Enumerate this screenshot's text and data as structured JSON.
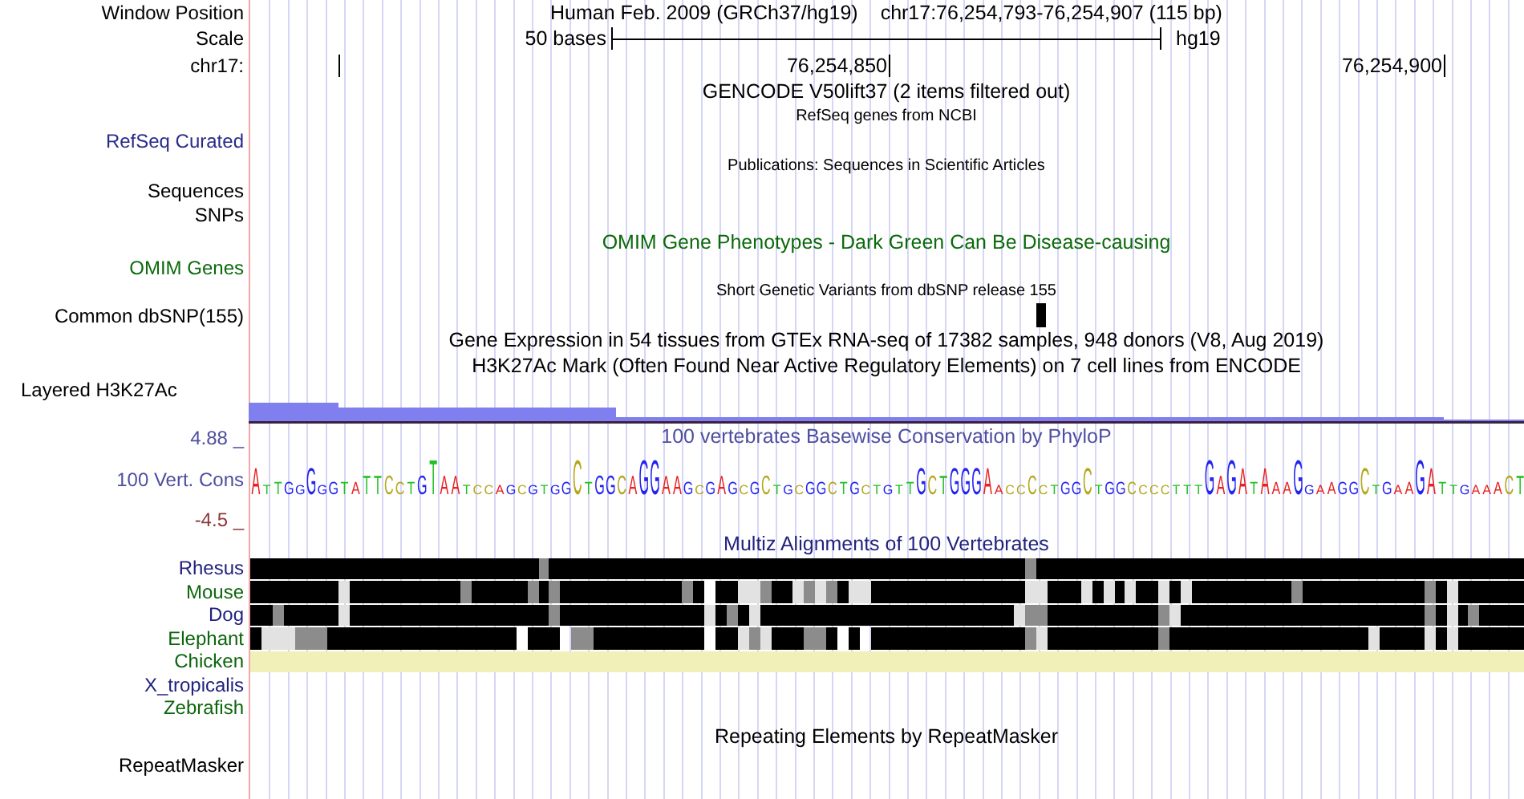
{
  "header": {
    "position_label": "Window Position",
    "assembly": "Human Feb. 2009 (GRCh37/hg19)",
    "position": "chr17:76,254,793-76,254,907 (115 bp)",
    "scale_label": "Scale",
    "scale": "50 bases",
    "scale_assembly": "hg19",
    "chrom_label": "chr17:",
    "tick_labels": [
      "76,254,850",
      "76,254,900"
    ]
  },
  "tracks": [
    {
      "kind": "gencode",
      "title": "GENCODE V50lift37 (2 items filtered out)"
    },
    {
      "kind": "refseq",
      "label": "RefSeq Curated",
      "title": "RefSeq genes from NCBI",
      "color": "#2a2a8c"
    },
    {
      "kind": "publications",
      "title": "Publications: Sequences in Scientific Articles"
    },
    {
      "kind": "sequences",
      "label": "Sequences",
      "color": "#000000"
    },
    {
      "kind": "snps",
      "label": "SNPs",
      "color": "#000000"
    },
    {
      "kind": "omim",
      "label": "OMIM Genes",
      "title": "OMIM Gene Phenotypes - Dark Green Can Be Disease-causing",
      "color": "#0b6a0b"
    },
    {
      "kind": "dbsnp",
      "label": "Common dbSNP(155)",
      "title": "Short Genetic Variants from dbSNP release 155",
      "color": "#000000"
    },
    {
      "kind": "gtex",
      "title": "Gene Expression in 54 tissues from GTEx RNA-seq of 17382 samples, 948 donors (V8, Aug 2019)"
    },
    {
      "kind": "h3k27ac",
      "label": "Layered H3K27Ac",
      "title": "H3K27Ac Mark (Often Found Near Active Regulatory Elements) on 7 cell lines from ENCODE",
      "color": "#000000"
    },
    {
      "kind": "phylop",
      "label": "100 Vert. Cons",
      "title": "100 vertebrates Basewise Conservation by PhyloP",
      "max": "4.88 _",
      "min": "-4.5 _",
      "color": "#4e4ea0",
      "bases": [
        {
          "base": "A",
          "kind": "high"
        },
        {
          "base": "T",
          "kind": "tiny"
        },
        {
          "base": "T",
          "kind": "low"
        },
        {
          "base": "G",
          "kind": "low"
        },
        {
          "base": "G",
          "kind": "tiny"
        },
        {
          "base": "G",
          "kind": "high"
        },
        {
          "base": "G",
          "kind": "tiny"
        },
        {
          "base": "G",
          "kind": "low"
        },
        {
          "base": "T",
          "kind": "low"
        },
        {
          "base": "A",
          "kind": "low"
        },
        {
          "base": "T",
          "kind": "mid"
        },
        {
          "base": "T",
          "kind": "mid"
        },
        {
          "base": "C",
          "kind": "mid"
        },
        {
          "base": "C",
          "kind": "low"
        },
        {
          "base": "T",
          "kind": "low"
        },
        {
          "base": "G",
          "kind": "mid"
        },
        {
          "base": "T",
          "kind": "tall"
        },
        {
          "base": "A",
          "kind": "mid"
        },
        {
          "base": "A",
          "kind": "mid"
        },
        {
          "base": "T",
          "kind": "tiny"
        },
        {
          "base": "C",
          "kind": "tiny"
        },
        {
          "base": "C",
          "kind": "tiny"
        },
        {
          "base": "A",
          "kind": "tiny"
        },
        {
          "base": "G",
          "kind": "tiny"
        },
        {
          "base": "C",
          "kind": "tiny"
        },
        {
          "base": "G",
          "kind": "tiny"
        },
        {
          "base": "T",
          "kind": "tiny"
        },
        {
          "base": "G",
          "kind": "tiny"
        },
        {
          "base": "G",
          "kind": "low"
        },
        {
          "base": "C",
          "kind": "tall"
        },
        {
          "base": "T",
          "kind": "low"
        },
        {
          "base": "G",
          "kind": "mid"
        },
        {
          "base": "G",
          "kind": "mid"
        },
        {
          "base": "C",
          "kind": "mid"
        },
        {
          "base": "A",
          "kind": "mid"
        },
        {
          "base": "G",
          "kind": "tall"
        },
        {
          "base": "G",
          "kind": "tall"
        },
        {
          "base": "A",
          "kind": "mid"
        },
        {
          "base": "A",
          "kind": "mid"
        },
        {
          "base": "G",
          "kind": "low"
        },
        {
          "base": "C",
          "kind": "tiny"
        },
        {
          "base": "G",
          "kind": "low"
        },
        {
          "base": "A",
          "kind": "mid"
        },
        {
          "base": "G",
          "kind": "low"
        },
        {
          "base": "C",
          "kind": "tiny"
        },
        {
          "base": "G",
          "kind": "low"
        },
        {
          "base": "C",
          "kind": "mid"
        },
        {
          "base": "T",
          "kind": "tiny"
        },
        {
          "base": "G",
          "kind": "tiny"
        },
        {
          "base": "C",
          "kind": "tiny"
        },
        {
          "base": "G",
          "kind": "low"
        },
        {
          "base": "G",
          "kind": "low"
        },
        {
          "base": "C",
          "kind": "low"
        },
        {
          "base": "T",
          "kind": "low"
        },
        {
          "base": "G",
          "kind": "low"
        },
        {
          "base": "C",
          "kind": "tiny"
        },
        {
          "base": "T",
          "kind": "tiny"
        },
        {
          "base": "G",
          "kind": "tiny"
        },
        {
          "base": "T",
          "kind": "tiny"
        },
        {
          "base": "T",
          "kind": "low"
        },
        {
          "base": "G",
          "kind": "high"
        },
        {
          "base": "C",
          "kind": "mid"
        },
        {
          "base": "T",
          "kind": "mid"
        },
        {
          "base": "G",
          "kind": "high"
        },
        {
          "base": "G",
          "kind": "high"
        },
        {
          "base": "G",
          "kind": "high"
        },
        {
          "base": "A",
          "kind": "high"
        },
        {
          "base": "A",
          "kind": "tiny"
        },
        {
          "base": "C",
          "kind": "tiny"
        },
        {
          "base": "C",
          "kind": "tiny"
        },
        {
          "base": "C",
          "kind": "mid"
        },
        {
          "base": "C",
          "kind": "tiny"
        },
        {
          "base": "T",
          "kind": "tiny"
        },
        {
          "base": "G",
          "kind": "low"
        },
        {
          "base": "G",
          "kind": "low"
        },
        {
          "base": "C",
          "kind": "high"
        },
        {
          "base": "T",
          "kind": "tiny"
        },
        {
          "base": "G",
          "kind": "low"
        },
        {
          "base": "G",
          "kind": "low"
        },
        {
          "base": "C",
          "kind": "low"
        },
        {
          "base": "C",
          "kind": "tiny"
        },
        {
          "base": "C",
          "kind": "tiny"
        },
        {
          "base": "C",
          "kind": "tiny"
        },
        {
          "base": "T",
          "kind": "tiny"
        },
        {
          "base": "T",
          "kind": "tiny"
        },
        {
          "base": "T",
          "kind": "tiny"
        },
        {
          "base": "G",
          "kind": "tall"
        },
        {
          "base": "A",
          "kind": "mid"
        },
        {
          "base": "G",
          "kind": "tall"
        },
        {
          "base": "A",
          "kind": "high"
        },
        {
          "base": "T",
          "kind": "low"
        },
        {
          "base": "A",
          "kind": "high"
        },
        {
          "base": "A",
          "kind": "low"
        },
        {
          "base": "A",
          "kind": "low"
        },
        {
          "base": "G",
          "kind": "tall"
        },
        {
          "base": "G",
          "kind": "tiny"
        },
        {
          "base": "A",
          "kind": "tiny"
        },
        {
          "base": "A",
          "kind": "low"
        },
        {
          "base": "G",
          "kind": "low"
        },
        {
          "base": "G",
          "kind": "low"
        },
        {
          "base": "C",
          "kind": "high"
        },
        {
          "base": "T",
          "kind": "tiny"
        },
        {
          "base": "G",
          "kind": "low"
        },
        {
          "base": "A",
          "kind": "tiny"
        },
        {
          "base": "A",
          "kind": "low"
        },
        {
          "base": "G",
          "kind": "tall"
        },
        {
          "base": "A",
          "kind": "high"
        },
        {
          "base": "T",
          "kind": "low"
        },
        {
          "base": "T",
          "kind": "tiny"
        },
        {
          "base": "G",
          "kind": "tiny"
        },
        {
          "base": "A",
          "kind": "tiny"
        },
        {
          "base": "A",
          "kind": "tiny"
        },
        {
          "base": "A",
          "kind": "low"
        },
        {
          "base": "C",
          "kind": "mid"
        },
        {
          "base": "T",
          "kind": "mid"
        }
      ]
    },
    {
      "kind": "multiz",
      "title": "Multiz Alignments of 100 Vertebrates",
      "species": [
        {
          "name": "Rhesus",
          "color": "#22227f",
          "kind": "alignment",
          "bases": [
            {
              "kind": "full"
            },
            {
              "kind": "full"
            },
            {
              "kind": "full"
            },
            {
              "kind": "full"
            },
            {
              "kind": "full"
            },
            {
              "kind": "full"
            },
            {
              "kind": "full"
            },
            {
              "kind": "full"
            },
            {
              "kind": "full"
            },
            {
              "kind": "full"
            },
            {
              "kind": "full"
            },
            {
              "kind": "full"
            },
            {
              "kind": "full"
            },
            {
              "kind": "full"
            },
            {
              "kind": "full"
            },
            {
              "kind": "full"
            },
            {
              "kind": "full"
            },
            {
              "kind": "full"
            },
            {
              "kind": "full"
            },
            {
              "kind": "full"
            },
            {
              "kind": "full"
            },
            {
              "kind": "full"
            },
            {
              "kind": "full"
            },
            {
              "kind": "full"
            },
            {
              "kind": "full"
            },
            {
              "kind": "full"
            },
            {
              "kind": "part"
            },
            {
              "kind": "full"
            },
            {
              "kind": "full"
            },
            {
              "kind": "full"
            },
            {
              "kind": "full"
            },
            {
              "kind": "full"
            },
            {
              "kind": "full"
            },
            {
              "kind": "full"
            },
            {
              "kind": "full"
            },
            {
              "kind": "full"
            },
            {
              "kind": "full"
            },
            {
              "kind": "full"
            },
            {
              "kind": "full"
            },
            {
              "kind": "full"
            },
            {
              "kind": "full"
            },
            {
              "kind": "full"
            },
            {
              "kind": "full"
            },
            {
              "kind": "full"
            },
            {
              "kind": "full"
            },
            {
              "kind": "full"
            },
            {
              "kind": "full"
            },
            {
              "kind": "full"
            },
            {
              "kind": "full"
            },
            {
              "kind": "full"
            },
            {
              "kind": "full"
            },
            {
              "kind": "full"
            },
            {
              "kind": "full"
            },
            {
              "kind": "full"
            },
            {
              "kind": "full"
            },
            {
              "kind": "full"
            },
            {
              "kind": "full"
            },
            {
              "kind": "full"
            },
            {
              "kind": "full"
            },
            {
              "kind": "full"
            },
            {
              "kind": "full"
            },
            {
              "kind": "full"
            },
            {
              "kind": "full"
            },
            {
              "kind": "full"
            },
            {
              "kind": "full"
            },
            {
              "kind": "full"
            },
            {
              "kind": "full"
            },
            {
              "kind": "full"
            },
            {
              "kind": "full"
            },
            {
              "kind": "full"
            },
            {
              "kind": "part"
            },
            {
              "kind": "full"
            },
            {
              "kind": "full"
            },
            {
              "kind": "full"
            },
            {
              "kind": "full"
            },
            {
              "kind": "full"
            },
            {
              "kind": "full"
            },
            {
              "kind": "full"
            },
            {
              "kind": "full"
            },
            {
              "kind": "full"
            },
            {
              "kind": "full"
            },
            {
              "kind": "full"
            },
            {
              "kind": "full"
            },
            {
              "kind": "full"
            },
            {
              "kind": "full"
            },
            {
              "kind": "full"
            },
            {
              "kind": "full"
            },
            {
              "kind": "full"
            },
            {
              "kind": "full"
            },
            {
              "kind": "full"
            },
            {
              "kind": "full"
            },
            {
              "kind": "full"
            },
            {
              "kind": "full"
            },
            {
              "kind": "full"
            },
            {
              "kind": "full"
            },
            {
              "kind": "full"
            },
            {
              "kind": "full"
            },
            {
              "kind": "full"
            },
            {
              "kind": "full"
            },
            {
              "kind": "full"
            },
            {
              "kind": "full"
            },
            {
              "kind": "full"
            },
            {
              "kind": "full"
            },
            {
              "kind": "full"
            },
            {
              "kind": "full"
            },
            {
              "kind": "full"
            },
            {
              "kind": "full"
            },
            {
              "kind": "full"
            },
            {
              "kind": "full"
            },
            {
              "kind": "full"
            },
            {
              "kind": "full"
            },
            {
              "kind": "full"
            },
            {
              "kind": "full"
            },
            {
              "kind": "full"
            },
            {
              "kind": "full"
            }
          ]
        },
        {
          "name": "Mouse",
          "color": "#0d660d",
          "kind": "alignment",
          "bases": [
            {
              "kind": "full"
            },
            {
              "kind": "full"
            },
            {
              "kind": "full"
            },
            {
              "kind": "full"
            },
            {
              "kind": "full"
            },
            {
              "kind": "full"
            },
            {
              "kind": "full"
            },
            {
              "kind": "full"
            },
            {
              "kind": "weak"
            },
            {
              "kind": "full"
            },
            {
              "kind": "full"
            },
            {
              "kind": "full"
            },
            {
              "kind": "full"
            },
            {
              "kind": "full"
            },
            {
              "kind": "full"
            },
            {
              "kind": "full"
            },
            {
              "kind": "full"
            },
            {
              "kind": "full"
            },
            {
              "kind": "full"
            },
            {
              "kind": "part"
            },
            {
              "kind": "full"
            },
            {
              "kind": "full"
            },
            {
              "kind": "full"
            },
            {
              "kind": "full"
            },
            {
              "kind": "full"
            },
            {
              "kind": "part"
            },
            {
              "kind": "full"
            },
            {
              "kind": "part"
            },
            {
              "kind": "full"
            },
            {
              "kind": "full"
            },
            {
              "kind": "full"
            },
            {
              "kind": "full"
            },
            {
              "kind": "full"
            },
            {
              "kind": "full"
            },
            {
              "kind": "full"
            },
            {
              "kind": "full"
            },
            {
              "kind": "full"
            },
            {
              "kind": "full"
            },
            {
              "kind": "full"
            },
            {
              "kind": "part"
            },
            {
              "kind": "full"
            },
            {
              "kind": "none"
            },
            {
              "kind": "full"
            },
            {
              "kind": "full"
            },
            {
              "kind": "weak"
            },
            {
              "kind": "weak"
            },
            {
              "kind": "part"
            },
            {
              "kind": "full"
            },
            {
              "kind": "full"
            },
            {
              "kind": "weak"
            },
            {
              "kind": "part"
            },
            {
              "kind": "weak"
            },
            {
              "kind": "part"
            },
            {
              "kind": "full"
            },
            {
              "kind": "weak"
            },
            {
              "kind": "weak"
            },
            {
              "kind": "full"
            },
            {
              "kind": "full"
            },
            {
              "kind": "full"
            },
            {
              "kind": "full"
            },
            {
              "kind": "full"
            },
            {
              "kind": "full"
            },
            {
              "kind": "full"
            },
            {
              "kind": "full"
            },
            {
              "kind": "full"
            },
            {
              "kind": "full"
            },
            {
              "kind": "full"
            },
            {
              "kind": "full"
            },
            {
              "kind": "full"
            },
            {
              "kind": "full"
            },
            {
              "kind": "weak"
            },
            {
              "kind": "weak"
            },
            {
              "kind": "full"
            },
            {
              "kind": "full"
            },
            {
              "kind": "full"
            },
            {
              "kind": "weak"
            },
            {
              "kind": "full"
            },
            {
              "kind": "weak"
            },
            {
              "kind": "full"
            },
            {
              "kind": "weak"
            },
            {
              "kind": "full"
            },
            {
              "kind": "full"
            },
            {
              "kind": "weak"
            },
            {
              "kind": "full"
            },
            {
              "kind": "weak"
            },
            {
              "kind": "full"
            },
            {
              "kind": "full"
            },
            {
              "kind": "full"
            },
            {
              "kind": "full"
            },
            {
              "kind": "full"
            },
            {
              "kind": "full"
            },
            {
              "kind": "full"
            },
            {
              "kind": "full"
            },
            {
              "kind": "full"
            },
            {
              "kind": "part"
            },
            {
              "kind": "full"
            },
            {
              "kind": "full"
            },
            {
              "kind": "full"
            },
            {
              "kind": "full"
            },
            {
              "kind": "full"
            },
            {
              "kind": "full"
            },
            {
              "kind": "full"
            },
            {
              "kind": "full"
            },
            {
              "kind": "full"
            },
            {
              "kind": "full"
            },
            {
              "kind": "full"
            },
            {
              "kind": "part"
            },
            {
              "kind": "full"
            },
            {
              "kind": "weak"
            },
            {
              "kind": "full"
            },
            {
              "kind": "full"
            },
            {
              "kind": "full"
            },
            {
              "kind": "full"
            },
            {
              "kind": "full"
            },
            {
              "kind": "full"
            }
          ]
        },
        {
          "name": "Dog",
          "color": "#22227f",
          "kind": "alignment",
          "bases": [
            {
              "kind": "full"
            },
            {
              "kind": "full"
            },
            {
              "kind": "part"
            },
            {
              "kind": "full"
            },
            {
              "kind": "full"
            },
            {
              "kind": "full"
            },
            {
              "kind": "full"
            },
            {
              "kind": "full"
            },
            {
              "kind": "weak"
            },
            {
              "kind": "full"
            },
            {
              "kind": "full"
            },
            {
              "kind": "full"
            },
            {
              "kind": "full"
            },
            {
              "kind": "full"
            },
            {
              "kind": "full"
            },
            {
              "kind": "full"
            },
            {
              "kind": "full"
            },
            {
              "kind": "full"
            },
            {
              "kind": "full"
            },
            {
              "kind": "full"
            },
            {
              "kind": "full"
            },
            {
              "kind": "full"
            },
            {
              "kind": "full"
            },
            {
              "kind": "full"
            },
            {
              "kind": "full"
            },
            {
              "kind": "full"
            },
            {
              "kind": "full"
            },
            {
              "kind": "part"
            },
            {
              "kind": "full"
            },
            {
              "kind": "full"
            },
            {
              "kind": "full"
            },
            {
              "kind": "full"
            },
            {
              "kind": "full"
            },
            {
              "kind": "full"
            },
            {
              "kind": "full"
            },
            {
              "kind": "full"
            },
            {
              "kind": "full"
            },
            {
              "kind": "full"
            },
            {
              "kind": "full"
            },
            {
              "kind": "full"
            },
            {
              "kind": "full"
            },
            {
              "kind": "weak"
            },
            {
              "kind": "full"
            },
            {
              "kind": "part"
            },
            {
              "kind": "full"
            },
            {
              "kind": "weak"
            },
            {
              "kind": "full"
            },
            {
              "kind": "full"
            },
            {
              "kind": "full"
            },
            {
              "kind": "full"
            },
            {
              "kind": "full"
            },
            {
              "kind": "full"
            },
            {
              "kind": "full"
            },
            {
              "kind": "full"
            },
            {
              "kind": "full"
            },
            {
              "kind": "full"
            },
            {
              "kind": "full"
            },
            {
              "kind": "full"
            },
            {
              "kind": "full"
            },
            {
              "kind": "full"
            },
            {
              "kind": "full"
            },
            {
              "kind": "full"
            },
            {
              "kind": "full"
            },
            {
              "kind": "full"
            },
            {
              "kind": "full"
            },
            {
              "kind": "full"
            },
            {
              "kind": "full"
            },
            {
              "kind": "full"
            },
            {
              "kind": "full"
            },
            {
              "kind": "weak"
            },
            {
              "kind": "part"
            },
            {
              "kind": "part"
            },
            {
              "kind": "full"
            },
            {
              "kind": "full"
            },
            {
              "kind": "full"
            },
            {
              "kind": "full"
            },
            {
              "kind": "full"
            },
            {
              "kind": "full"
            },
            {
              "kind": "full"
            },
            {
              "kind": "full"
            },
            {
              "kind": "full"
            },
            {
              "kind": "full"
            },
            {
              "kind": "part"
            },
            {
              "kind": "weak"
            },
            {
              "kind": "full"
            },
            {
              "kind": "full"
            },
            {
              "kind": "full"
            },
            {
              "kind": "full"
            },
            {
              "kind": "full"
            },
            {
              "kind": "full"
            },
            {
              "kind": "full"
            },
            {
              "kind": "full"
            },
            {
              "kind": "full"
            },
            {
              "kind": "full"
            },
            {
              "kind": "full"
            },
            {
              "kind": "full"
            },
            {
              "kind": "full"
            },
            {
              "kind": "full"
            },
            {
              "kind": "full"
            },
            {
              "kind": "full"
            },
            {
              "kind": "full"
            },
            {
              "kind": "full"
            },
            {
              "kind": "full"
            },
            {
              "kind": "full"
            },
            {
              "kind": "full"
            },
            {
              "kind": "full"
            },
            {
              "kind": "part"
            },
            {
              "kind": "full"
            },
            {
              "kind": "weak"
            },
            {
              "kind": "full"
            },
            {
              "kind": "part"
            },
            {
              "kind": "full"
            },
            {
              "kind": "full"
            },
            {
              "kind": "full"
            },
            {
              "kind": "full"
            }
          ]
        },
        {
          "name": "Elephant",
          "color": "#0d660d",
          "kind": "alignment",
          "bases": [
            {
              "kind": "full"
            },
            {
              "kind": "weak"
            },
            {
              "kind": "weak"
            },
            {
              "kind": "weak"
            },
            {
              "kind": "part"
            },
            {
              "kind": "part"
            },
            {
              "kind": "part"
            },
            {
              "kind": "full"
            },
            {
              "kind": "full"
            },
            {
              "kind": "full"
            },
            {
              "kind": "full"
            },
            {
              "kind": "full"
            },
            {
              "kind": "full"
            },
            {
              "kind": "full"
            },
            {
              "kind": "full"
            },
            {
              "kind": "full"
            },
            {
              "kind": "full"
            },
            {
              "kind": "full"
            },
            {
              "kind": "full"
            },
            {
              "kind": "full"
            },
            {
              "kind": "full"
            },
            {
              "kind": "full"
            },
            {
              "kind": "full"
            },
            {
              "kind": "full"
            },
            {
              "kind": "none"
            },
            {
              "kind": "full"
            },
            {
              "kind": "full"
            },
            {
              "kind": "full"
            },
            {
              "kind": "none"
            },
            {
              "kind": "part"
            },
            {
              "kind": "part"
            },
            {
              "kind": "full"
            },
            {
              "kind": "full"
            },
            {
              "kind": "full"
            },
            {
              "kind": "full"
            },
            {
              "kind": "full"
            },
            {
              "kind": "full"
            },
            {
              "kind": "full"
            },
            {
              "kind": "full"
            },
            {
              "kind": "full"
            },
            {
              "kind": "full"
            },
            {
              "kind": "none"
            },
            {
              "kind": "full"
            },
            {
              "kind": "full"
            },
            {
              "kind": "weak"
            },
            {
              "kind": "part"
            },
            {
              "kind": "weak"
            },
            {
              "kind": "full"
            },
            {
              "kind": "full"
            },
            {
              "kind": "full"
            },
            {
              "kind": "part"
            },
            {
              "kind": "part"
            },
            {
              "kind": "full"
            },
            {
              "kind": "none"
            },
            {
              "kind": "full"
            },
            {
              "kind": "none"
            },
            {
              "kind": "full"
            },
            {
              "kind": "full"
            },
            {
              "kind": "full"
            },
            {
              "kind": "full"
            },
            {
              "kind": "full"
            },
            {
              "kind": "full"
            },
            {
              "kind": "full"
            },
            {
              "kind": "full"
            },
            {
              "kind": "full"
            },
            {
              "kind": "full"
            },
            {
              "kind": "full"
            },
            {
              "kind": "full"
            },
            {
              "kind": "full"
            },
            {
              "kind": "full"
            },
            {
              "kind": "part"
            },
            {
              "kind": "weak"
            },
            {
              "kind": "full"
            },
            {
              "kind": "full"
            },
            {
              "kind": "full"
            },
            {
              "kind": "full"
            },
            {
              "kind": "full"
            },
            {
              "kind": "full"
            },
            {
              "kind": "full"
            },
            {
              "kind": "full"
            },
            {
              "kind": "full"
            },
            {
              "kind": "full"
            },
            {
              "kind": "part"
            },
            {
              "kind": "full"
            },
            {
              "kind": "full"
            },
            {
              "kind": "full"
            },
            {
              "kind": "full"
            },
            {
              "kind": "full"
            },
            {
              "kind": "full"
            },
            {
              "kind": "full"
            },
            {
              "kind": "full"
            },
            {
              "kind": "full"
            },
            {
              "kind": "full"
            },
            {
              "kind": "full"
            },
            {
              "kind": "full"
            },
            {
              "kind": "full"
            },
            {
              "kind": "full"
            },
            {
              "kind": "full"
            },
            {
              "kind": "full"
            },
            {
              "kind": "full"
            },
            {
              "kind": "full"
            },
            {
              "kind": "weak"
            },
            {
              "kind": "full"
            },
            {
              "kind": "full"
            },
            {
              "kind": "full"
            },
            {
              "kind": "full"
            },
            {
              "kind": "weak"
            },
            {
              "kind": "full"
            },
            {
              "kind": "weak"
            },
            {
              "kind": "full"
            },
            {
              "kind": "full"
            },
            {
              "kind": "full"
            },
            {
              "kind": "full"
            },
            {
              "kind": "full"
            },
            {
              "kind": "full"
            }
          ]
        },
        {
          "name": "Chicken",
          "color": "#0d660d",
          "kind": "pale"
        },
        {
          "name": "X_tropicalis",
          "color": "#22227f",
          "kind": "none"
        },
        {
          "name": "Zebrafish",
          "color": "#0d660d",
          "kind": "none"
        }
      ]
    },
    {
      "kind": "repeatmasker",
      "label": "RepeatMasker",
      "title": "Repeating Elements by RepeatMasker",
      "color": "#000000"
    }
  ]
}
